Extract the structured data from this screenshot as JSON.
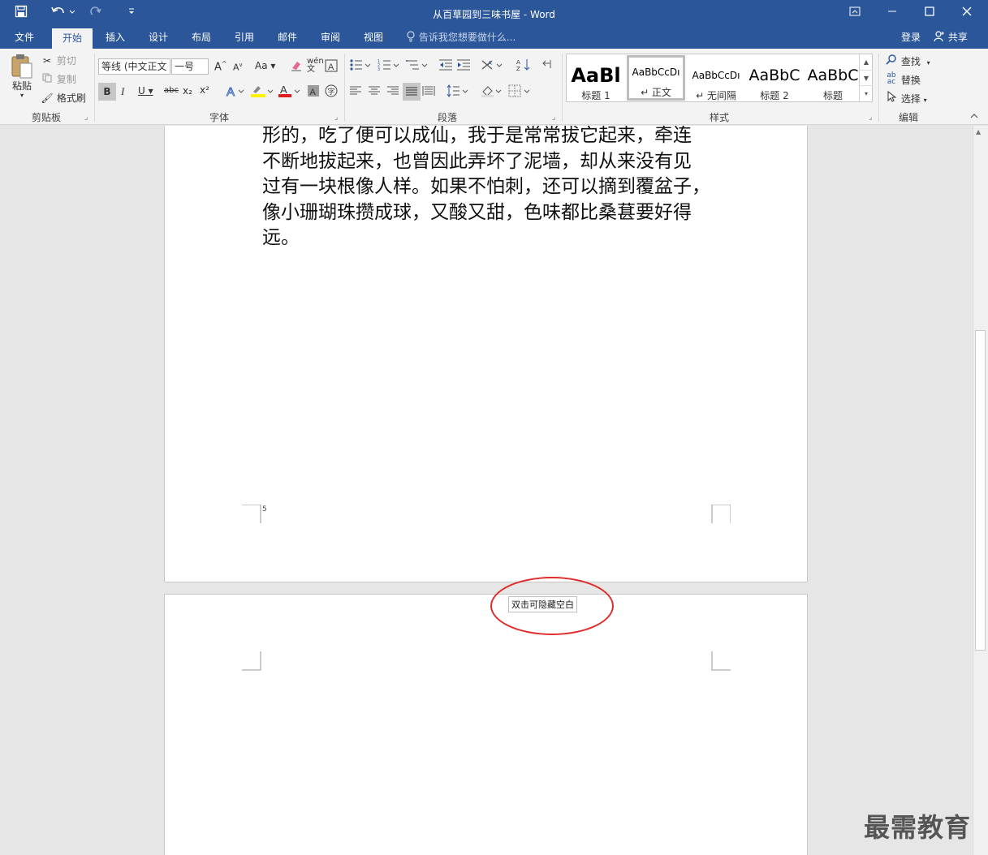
{
  "window": {
    "title": "从百草园到三味书屋 - Word",
    "accent": "#2b579a"
  },
  "quick_access": {
    "save_icon": "save-icon",
    "undo_icon": "undo-icon",
    "redo_icon": "redo-icon",
    "customize_icon": "customize-icon"
  },
  "tabs": [
    "文件",
    "开始",
    "插入",
    "设计",
    "布局",
    "引用",
    "邮件",
    "审阅",
    "视图"
  ],
  "active_tab": "开始",
  "tell_me": "告诉我您想要做什么...",
  "signin": "登录",
  "share": "共享",
  "ribbon": {
    "clipboard": {
      "label": "剪贴板",
      "paste": "粘贴",
      "cut": "剪切",
      "copy": "复制",
      "format_painter": "格式刷"
    },
    "font": {
      "label": "字体",
      "font_name": "等线 (中文正文",
      "font_size": "一号",
      "grow": "A",
      "shrink": "A",
      "case": "Aa",
      "bold": "B",
      "italic": "I",
      "underline": "U",
      "strike": "abc",
      "subscript": "x₂",
      "superscript": "x²"
    },
    "paragraph": {
      "label": "段落"
    },
    "styles": {
      "label": "样式",
      "items": [
        {
          "preview": "AaBl",
          "name": "标题 1"
        },
        {
          "preview": "AaBbCcDı",
          "name": "↵ 正文"
        },
        {
          "preview": "AaBbCcDı",
          "name": "↵ 无间隔"
        },
        {
          "preview": "AaBbC",
          "name": "标题 2"
        },
        {
          "preview": "AaBbC",
          "name": "标题"
        }
      ]
    },
    "editing": {
      "label": "编辑",
      "find": "查找",
      "replace": "替换",
      "select": "选择"
    }
  },
  "document": {
    "lines": [
      "形的，吃了便可以成仙，我于是常常拔它起来，牵连",
      "不断地拔起来，也曾因此弄坏了泥墙，却从来没有见",
      "过有一块根像人样。如果不怕刺，还可以摘到覆盆子，",
      "像小珊瑚珠攒成球，又酸又甜，色味都比桑葚要好得",
      "远。"
    ],
    "page_number": "5",
    "tooltip": "双击可隐藏空白",
    "highlight_color": "#e02a2a"
  },
  "watermark": "最需教育"
}
